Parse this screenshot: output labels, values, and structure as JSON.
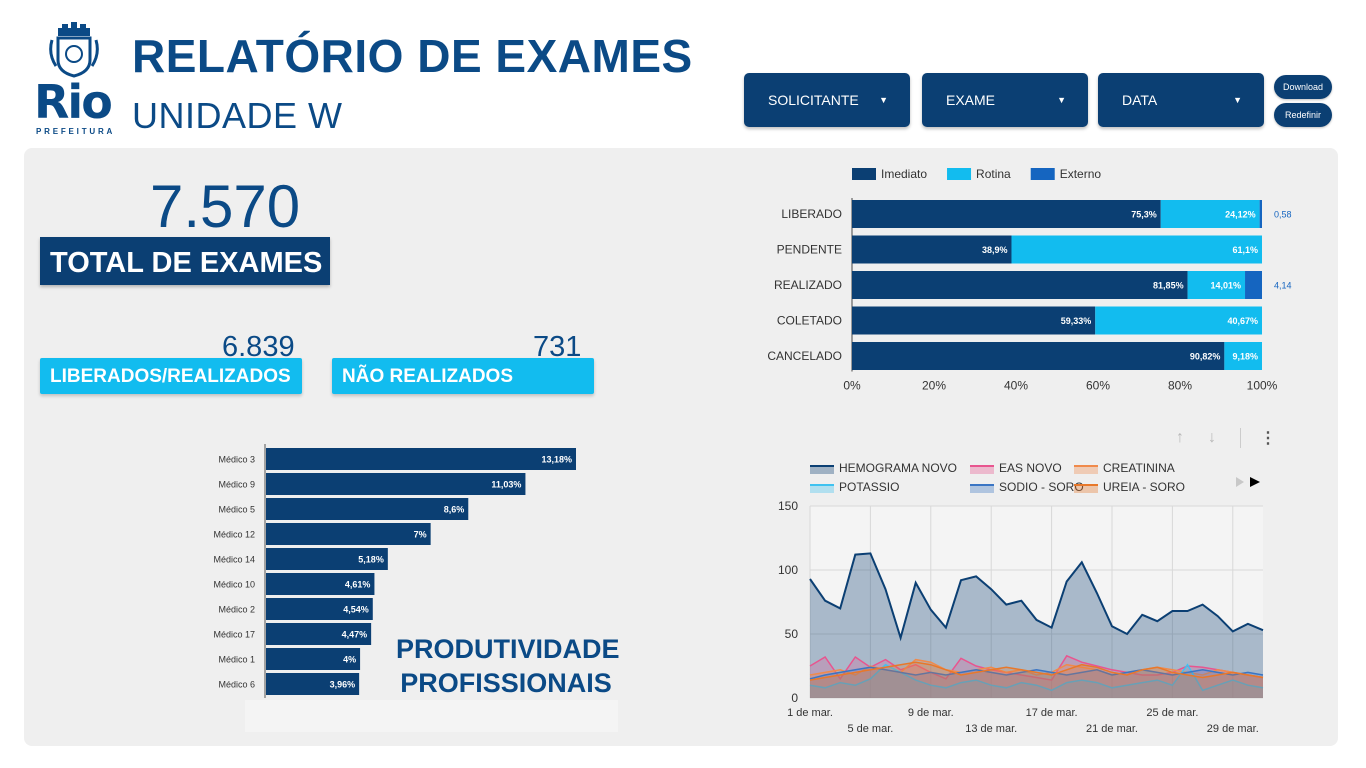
{
  "header": {
    "logo_text": "Rio",
    "logo_subtext": "PREFEITURA",
    "title": "RELATÓRIO DE EXAMES",
    "subtitle": "UNIDADE W"
  },
  "filters": [
    {
      "label": "SOLICITANTE"
    },
    {
      "label": "EXAME"
    },
    {
      "label": "DATA"
    }
  ],
  "buttons": {
    "download": "Download",
    "reset": "Redefinir"
  },
  "kpis": {
    "total_value": "7.570",
    "total_label": "TOTAL DE EXAMES",
    "released_value": "6.839",
    "released_label": "LIBERADOS/REALIZADOS",
    "not_done_value": "731",
    "not_done_label": "NÃO  REALIZADOS"
  },
  "productivity_title_line1": "PRODUTIVIDADE",
  "productivity_title_line2": "PROFISSIONAIS",
  "colors": {
    "dark": "#0b3f73",
    "cyan": "#12bcef",
    "blue": "#1565c0",
    "panel": "#efefef"
  },
  "chart_data": [
    {
      "type": "bar",
      "orientation": "horizontal-stacked-100",
      "legend": [
        "Imediato",
        "Rotina",
        "Externo"
      ],
      "legend_position": "top",
      "categories": [
        "LIBERADO",
        "PENDENTE",
        "REALIZADO",
        "COLETADO",
        "CANCELADO"
      ],
      "series": [
        {
          "name": "Imediato",
          "values": [
            75.3,
            38.9,
            81.85,
            59.33,
            90.82
          ],
          "labels": [
            "75,3%",
            "38,9%",
            "81,85%",
            "59,33%",
            "90,82%"
          ],
          "color": "#0b3f73"
        },
        {
          "name": "Rotina",
          "values": [
            24.12,
            61.1,
            14.01,
            40.67,
            9.18
          ],
          "labels": [
            "24,12%",
            "61,1%",
            "14,01%",
            "40,67%",
            "9,18%"
          ],
          "color": "#12bcef"
        },
        {
          "name": "Externo",
          "values": [
            0.58,
            0,
            4.14,
            0,
            0
          ],
          "labels": [
            "0,58",
            "",
            "4,14",
            "",
            ""
          ],
          "color": "#1565c0"
        }
      ],
      "xticks": [
        "0%",
        "20%",
        "40%",
        "60%",
        "80%",
        "100%"
      ],
      "xlim": [
        0,
        100
      ]
    },
    {
      "type": "bar",
      "orientation": "horizontal",
      "categories": [
        "Médico 3",
        "Médico 9",
        "Médico 5",
        "Médico 12",
        "Médico 14",
        "Médico 10",
        "Médico 2",
        "Médico 17",
        "Médico 1",
        "Médico 6"
      ],
      "values": [
        13.18,
        11.03,
        8.6,
        7,
        5.18,
        4.61,
        4.54,
        4.47,
        4,
        3.96
      ],
      "labels": [
        "13,18%",
        "11,03%",
        "8,6%",
        "7%",
        "5,18%",
        "4,61%",
        "4,54%",
        "4,47%",
        "4%",
        "3,96%"
      ],
      "color": "#0b3f73"
    },
    {
      "type": "area",
      "legend_position": "top",
      "x": [
        "1 de mar.",
        "2",
        "3",
        "4",
        "5 de mar.",
        "6",
        "7",
        "8",
        "9 de mar.",
        "10",
        "11",
        "12",
        "13 de mar.",
        "14",
        "15",
        "16",
        "17 de mar.",
        "18",
        "19",
        "20",
        "21 de mar.",
        "22",
        "23",
        "24",
        "25 de mar.",
        "26",
        "27",
        "28",
        "29 de mar.",
        "30",
        "31"
      ],
      "xticks_top": [
        "1 de mar.",
        "9 de mar.",
        "17 de mar.",
        "25 de mar."
      ],
      "xticks_bottom": [
        "5 de mar.",
        "13 de mar.",
        "21 de mar.",
        "29 de mar."
      ],
      "yticks": [
        "0",
        "50",
        "100",
        "150"
      ],
      "ylim": [
        0,
        150
      ],
      "grid": true,
      "series": [
        {
          "name": "HEMOGRAMA NOVO",
          "color": "#0b3f73",
          "values": [
            93,
            76,
            70,
            112,
            113,
            85,
            47,
            90,
            69,
            55,
            92,
            95,
            85,
            73,
            76,
            61,
            55,
            91,
            106,
            82,
            56,
            50,
            65,
            60,
            68,
            68,
            73,
            64,
            52,
            58,
            53
          ]
        },
        {
          "name": "EAS NOVO",
          "color": "#e8558f",
          "values": [
            25,
            32,
            15,
            32,
            24,
            30,
            22,
            26,
            20,
            15,
            31,
            25,
            22,
            20,
            18,
            16,
            14,
            33,
            28,
            25,
            22,
            20,
            18,
            18,
            20,
            25,
            24,
            22,
            20,
            18,
            16
          ]
        },
        {
          "name": "CREATININA",
          "color": "#f08a4b",
          "values": [
            18,
            20,
            22,
            18,
            25,
            22,
            20,
            30,
            28,
            22,
            20,
            22,
            24,
            20,
            22,
            18,
            20,
            26,
            24,
            22,
            18,
            20,
            22,
            24,
            22,
            20,
            18,
            22,
            20,
            18,
            16
          ]
        },
        {
          "name": "POTASSIO",
          "color": "#3fc2f0",
          "values": [
            10,
            8,
            12,
            10,
            15,
            26,
            20,
            14,
            10,
            8,
            12,
            14,
            10,
            8,
            12,
            10,
            6,
            12,
            14,
            12,
            8,
            10,
            12,
            14,
            10,
            26,
            6,
            10,
            14,
            10,
            8
          ]
        },
        {
          "name": "SODIO - SORO",
          "color": "#3a75c4",
          "values": [
            15,
            18,
            20,
            22,
            24,
            22,
            20,
            18,
            20,
            18,
            20,
            22,
            20,
            18,
            20,
            22,
            20,
            18,
            20,
            22,
            18,
            20,
            22,
            20,
            18,
            20,
            22,
            20,
            18,
            20,
            18
          ]
        },
        {
          "name": "UREIA - SORO",
          "color": "#e8782a",
          "values": [
            14,
            16,
            18,
            20,
            22,
            24,
            26,
            28,
            26,
            22,
            18,
            20,
            22,
            24,
            22,
            20,
            18,
            22,
            26,
            24,
            20,
            18,
            22,
            24,
            20,
            18,
            16,
            18,
            20,
            18,
            16
          ]
        }
      ]
    }
  ]
}
